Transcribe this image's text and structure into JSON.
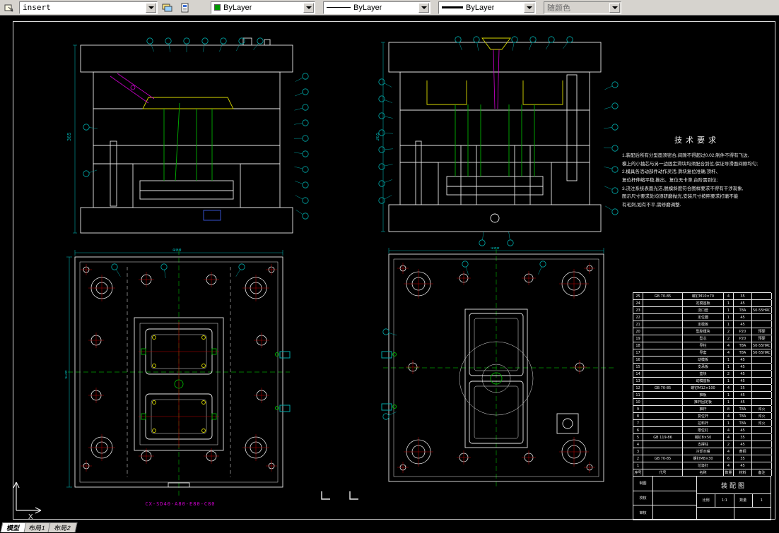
{
  "toolbar": {
    "block_combo": {
      "value": "insert"
    },
    "color_combo": {
      "value": "ByLayer",
      "swatch": "#009900"
    },
    "linetype_combo": {
      "value": "ByLayer"
    },
    "lineweight_combo": {
      "value": "ByLayer"
    },
    "plotstyle_combo": {
      "value": "随颜色"
    }
  },
  "statusbar": {
    "tabs": [
      "模型",
      "布局1",
      "布局2"
    ],
    "active": "模型"
  },
  "tech_requirements": {
    "title": "技术要求",
    "lines": [
      "1.装配后所有分型面须密合,间隙不得超过0.02,制件不得有飞边,",
      "模上的小抽芯与另一边固定滑块均须配合到位,保证导滑面间隙均匀;",
      "2.模具各活动部件动作灵活,滑块复位准确,顶杆、",
      "复位杆伸缩平稳,推出、复位无卡滞,台阶需到位;",
      "3.浇注系统表面光洁,脱模斜度符合图样要求不得有干涉现象,",
      "图示尺寸要求处均须研磨抛光,安装尺寸按照要求打磨不能",
      "有毛刺,如有不平,需修磨调整."
    ]
  },
  "views": {
    "bottom_left_label": "CX-SD40-A80-E80-C80"
  },
  "dims": {
    "sec_left_total": "365",
    "sec_right_total": "365",
    "plan_left_width": "400",
    "plan_left_height": "450",
    "plan_right_width": "400"
  },
  "bom": {
    "headers": [
      "序号",
      "代号",
      "名称",
      "数量",
      "材料",
      "备注"
    ],
    "rows": [
      [
        "25",
        "GB 70-85",
        "螺钉M10×70",
        "4",
        "35",
        ""
      ],
      [
        "24",
        "",
        "定模座板",
        "1",
        "45",
        ""
      ],
      [
        "23",
        "",
        "浇口套",
        "1",
        "T8A",
        "50-55HRC"
      ],
      [
        "22",
        "",
        "定位圈",
        "1",
        "45",
        ""
      ],
      [
        "21",
        "",
        "定模板",
        "1",
        "45",
        ""
      ],
      [
        "20",
        "",
        "型腔镶块",
        "2",
        "P20",
        "预硬"
      ],
      [
        "19",
        "",
        "型芯",
        "2",
        "P20",
        "预硬"
      ],
      [
        "18",
        "",
        "导柱",
        "4",
        "T8A",
        "50-55HRC"
      ],
      [
        "17",
        "",
        "导套",
        "4",
        "T8A",
        "50-55HRC"
      ],
      [
        "16",
        "",
        "动模板",
        "1",
        "45",
        ""
      ],
      [
        "15",
        "",
        "支承板",
        "1",
        "45",
        ""
      ],
      [
        "14",
        "",
        "垫块",
        "2",
        "45",
        ""
      ],
      [
        "13",
        "",
        "动模座板",
        "1",
        "45",
        ""
      ],
      [
        "12",
        "GB 70-85",
        "螺钉M12×100",
        "4",
        "35",
        ""
      ],
      [
        "11",
        "",
        "推板",
        "1",
        "45",
        ""
      ],
      [
        "10",
        "",
        "推杆固定板",
        "1",
        "45",
        ""
      ],
      [
        "9",
        "",
        "推杆",
        "8",
        "T8A",
        "淬火"
      ],
      [
        "8",
        "",
        "复位杆",
        "4",
        "T8A",
        "淬火"
      ],
      [
        "7",
        "",
        "拉料杆",
        "1",
        "T8A",
        "淬火"
      ],
      [
        "6",
        "",
        "限位钉",
        "4",
        "45",
        ""
      ],
      [
        "5",
        "GB 119-86",
        "销钉8×50",
        "4",
        "35",
        ""
      ],
      [
        "4",
        "",
        "支撑柱",
        "2",
        "45",
        ""
      ],
      [
        "3",
        "",
        "冷却水嘴",
        "4",
        "黄铜",
        ""
      ],
      [
        "2",
        "GB 70-85",
        "螺钉M8×30",
        "6",
        "35",
        ""
      ],
      [
        "1",
        "",
        "垃圾钉",
        "4",
        "45",
        ""
      ]
    ]
  },
  "title_block": {
    "drafted": "制图",
    "checked": "校核",
    "approved": "审核",
    "name": "装配图",
    "scale_label": "比例",
    "scale": "1:1",
    "qty_label": "数量",
    "qty": "1"
  },
  "ucs": {
    "x_label": "X"
  }
}
